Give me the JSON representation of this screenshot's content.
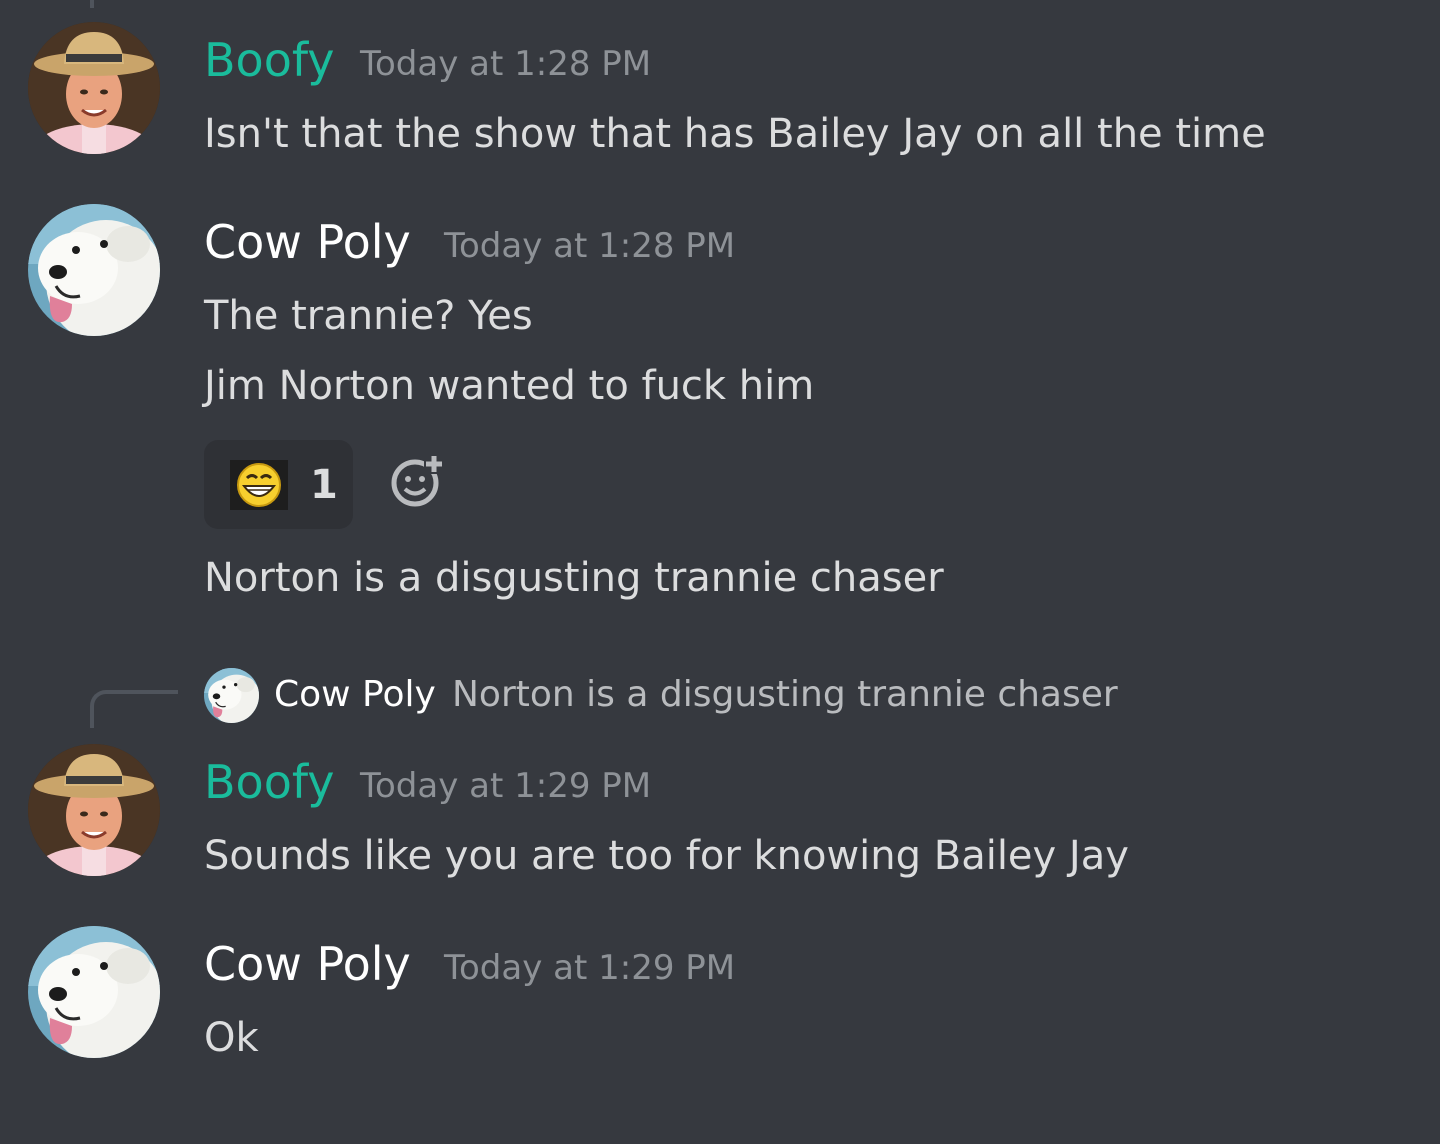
{
  "colors": {
    "background": "#36393f",
    "username_boofy": "#1abc9c",
    "username_cowpoly": "#ffffff",
    "timestamp": "#8e9297",
    "message_text": "#dcddde",
    "reaction_bg": "#2f3136"
  },
  "messages": [
    {
      "author": "Boofy",
      "avatar_icon": "man-straw-hat-avatar",
      "timestamp": "Today at 1:28 PM",
      "lines": [
        "Isn't that the show that has Bailey Jay on all the time"
      ]
    },
    {
      "author": "Cow Poly",
      "avatar_icon": "white-dog-avatar",
      "timestamp": "Today at 1:28 PM",
      "lines": [
        "The trannie? Yes",
        "Jim Norton wanted to fuck him"
      ],
      "reaction": {
        "emoji_icon": "grinning-face-emoji",
        "count": "1"
      },
      "add_reaction_icon": "add-reaction-icon",
      "followup": "Norton is a disgusting trannie chaser"
    },
    {
      "reply_to": {
        "author": "Cow Poly",
        "text": "Norton is a disgusting trannie chaser"
      },
      "author": "Boofy",
      "avatar_icon": "man-straw-hat-avatar",
      "timestamp": "Today at 1:29 PM",
      "lines": [
        "Sounds like you are too for knowing Bailey Jay"
      ]
    },
    {
      "author": "Cow Poly",
      "avatar_icon": "white-dog-avatar",
      "timestamp": "Today at 1:29 PM",
      "lines": [
        "Ok"
      ]
    }
  ]
}
